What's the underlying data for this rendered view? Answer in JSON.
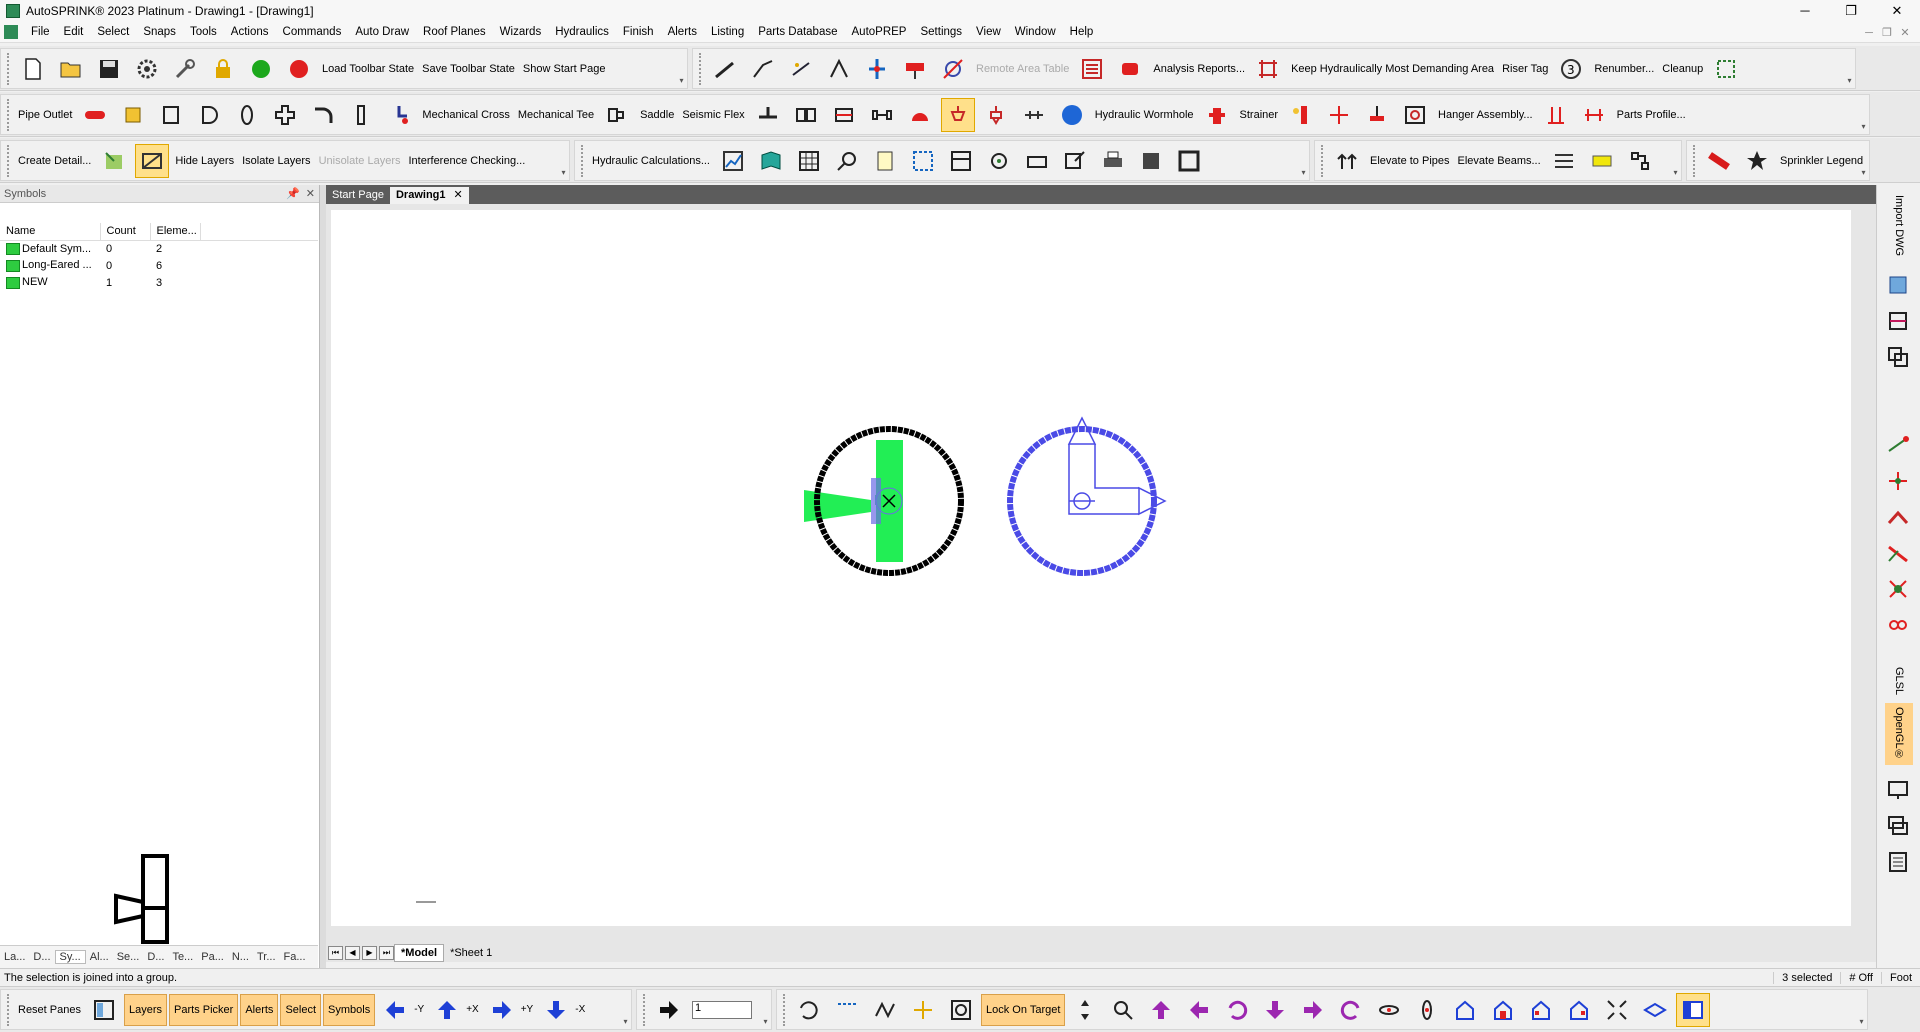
{
  "window": {
    "title": "AutoSPRINK® 2023 Platinum - Drawing1 - [Drawing1]"
  },
  "menu": [
    "File",
    "Edit",
    "Select",
    "Snaps",
    "Tools",
    "Actions",
    "Commands",
    "Auto Draw",
    "Roof Planes",
    "Wizards",
    "Hydraulics",
    "Finish",
    "Alerts",
    "Listing",
    "Parts Database",
    "AutoPREP",
    "Settings",
    "View",
    "Window",
    "Help"
  ],
  "toolbar1": {
    "load_toolbar_state": "Load Toolbar State",
    "save_toolbar_state": "Save Toolbar State",
    "show_start_page": "Show Start Page",
    "remote_area_table": "Remote Area Table",
    "analysis_reports": "Analysis Reports...",
    "keep_hydraulically": "Keep Hydraulically Most Demanding Area",
    "riser_tag": "Riser Tag",
    "renumber": "Renumber...",
    "cleanup": "Cleanup"
  },
  "toolbar2": {
    "pipe_outlet": "Pipe Outlet",
    "mechanical_cross": "Mechanical Cross",
    "mechanical_tee": "Mechanical Tee",
    "saddle": "Saddle",
    "seismic_flex": "Seismic Flex",
    "hydraulic_wormhole": "Hydraulic Wormhole",
    "strainer": "Strainer",
    "hanger_assembly": "Hanger Assembly...",
    "parts_profile": "Parts Profile..."
  },
  "toolbar3": {
    "create_detail": "Create Detail...",
    "hide_layers": "Hide Layers",
    "isolate_layers": "Isolate Layers",
    "unisolate_layers": "Unisolate Layers",
    "interference_checking": "Interference Checking...",
    "hydraulic_calculations": "Hydraulic Calculations...",
    "elevate_to_pipes": "Elevate to Pipes",
    "elevate_beams": "Elevate Beams...",
    "sprinkler_legend": "Sprinkler Legend"
  },
  "symbols_panel": {
    "title": "Symbols",
    "pin": "📌",
    "close": "✕",
    "columns": [
      "Name",
      "Count",
      "Eleme..."
    ],
    "rows": [
      {
        "name": "Default Sym...",
        "count": "0",
        "elements": "2"
      },
      {
        "name": "Long-Eared ...",
        "count": "0",
        "elements": "6"
      },
      {
        "name": "NEW",
        "count": "1",
        "elements": "3"
      }
    ],
    "tabs": [
      "La...",
      "D...",
      "Sy...",
      "Al...",
      "Se...",
      "D...",
      "Te...",
      "Pa...",
      "N...",
      "Tr...",
      "Fa..."
    ]
  },
  "doc_tabs": {
    "start_page": "Start Page",
    "drawing1": "Drawing1",
    "close": "✕"
  },
  "sheet_tabs": {
    "nav": [
      "⏮",
      "◀",
      "▶",
      "⏭"
    ],
    "model": "*Model",
    "sheet1": "*Sheet 1"
  },
  "right_bar": {
    "import_dwg": "Import DWG",
    "glsl": "GLSL",
    "opengl": "OpenGL®"
  },
  "status": {
    "message": "The selection is joined into a group.",
    "selected": "3 selected",
    "mode": "# Off",
    "units": "Foot"
  },
  "bottom": {
    "reset_panes": "Reset Panes",
    "layers": "Layers",
    "parts_picker": "Parts Picker",
    "alerts": "Alerts",
    "select": "Select",
    "symbols": "Symbols",
    "neg_y": "-Y",
    "pos_x": "+X",
    "pos_y": "+Y",
    "neg_x": "-X",
    "zoom_value": "1",
    "lock_on_target": "Lock On Target"
  },
  "colors": {
    "accent_yellow": "#ffd28a",
    "sprinkler_green": "#22ee55",
    "symbol_blue": "#4a4ae6",
    "dark_tab": "#5c5c5c"
  }
}
